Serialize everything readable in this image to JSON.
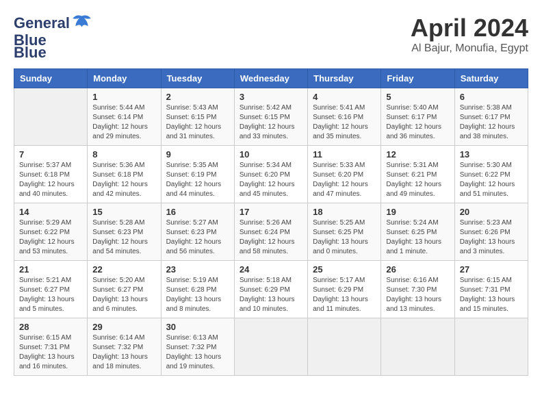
{
  "header": {
    "logo_line1": "General",
    "logo_line2": "Blue",
    "month": "April 2024",
    "location": "Al Bajur, Monufia, Egypt"
  },
  "weekdays": [
    "Sunday",
    "Monday",
    "Tuesday",
    "Wednesday",
    "Thursday",
    "Friday",
    "Saturday"
  ],
  "weeks": [
    [
      {
        "day": "",
        "sunrise": "",
        "sunset": "",
        "daylight": ""
      },
      {
        "day": "1",
        "sunrise": "Sunrise: 5:44 AM",
        "sunset": "Sunset: 6:14 PM",
        "daylight": "Daylight: 12 hours and 29 minutes."
      },
      {
        "day": "2",
        "sunrise": "Sunrise: 5:43 AM",
        "sunset": "Sunset: 6:15 PM",
        "daylight": "Daylight: 12 hours and 31 minutes."
      },
      {
        "day": "3",
        "sunrise": "Sunrise: 5:42 AM",
        "sunset": "Sunset: 6:15 PM",
        "daylight": "Daylight: 12 hours and 33 minutes."
      },
      {
        "day": "4",
        "sunrise": "Sunrise: 5:41 AM",
        "sunset": "Sunset: 6:16 PM",
        "daylight": "Daylight: 12 hours and 35 minutes."
      },
      {
        "day": "5",
        "sunrise": "Sunrise: 5:40 AM",
        "sunset": "Sunset: 6:17 PM",
        "daylight": "Daylight: 12 hours and 36 minutes."
      },
      {
        "day": "6",
        "sunrise": "Sunrise: 5:38 AM",
        "sunset": "Sunset: 6:17 PM",
        "daylight": "Daylight: 12 hours and 38 minutes."
      }
    ],
    [
      {
        "day": "7",
        "sunrise": "Sunrise: 5:37 AM",
        "sunset": "Sunset: 6:18 PM",
        "daylight": "Daylight: 12 hours and 40 minutes."
      },
      {
        "day": "8",
        "sunrise": "Sunrise: 5:36 AM",
        "sunset": "Sunset: 6:18 PM",
        "daylight": "Daylight: 12 hours and 42 minutes."
      },
      {
        "day": "9",
        "sunrise": "Sunrise: 5:35 AM",
        "sunset": "Sunset: 6:19 PM",
        "daylight": "Daylight: 12 hours and 44 minutes."
      },
      {
        "day": "10",
        "sunrise": "Sunrise: 5:34 AM",
        "sunset": "Sunset: 6:20 PM",
        "daylight": "Daylight: 12 hours and 45 minutes."
      },
      {
        "day": "11",
        "sunrise": "Sunrise: 5:33 AM",
        "sunset": "Sunset: 6:20 PM",
        "daylight": "Daylight: 12 hours and 47 minutes."
      },
      {
        "day": "12",
        "sunrise": "Sunrise: 5:31 AM",
        "sunset": "Sunset: 6:21 PM",
        "daylight": "Daylight: 12 hours and 49 minutes."
      },
      {
        "day": "13",
        "sunrise": "Sunrise: 5:30 AM",
        "sunset": "Sunset: 6:22 PM",
        "daylight": "Daylight: 12 hours and 51 minutes."
      }
    ],
    [
      {
        "day": "14",
        "sunrise": "Sunrise: 5:29 AM",
        "sunset": "Sunset: 6:22 PM",
        "daylight": "Daylight: 12 hours and 53 minutes."
      },
      {
        "day": "15",
        "sunrise": "Sunrise: 5:28 AM",
        "sunset": "Sunset: 6:23 PM",
        "daylight": "Daylight: 12 hours and 54 minutes."
      },
      {
        "day": "16",
        "sunrise": "Sunrise: 5:27 AM",
        "sunset": "Sunset: 6:23 PM",
        "daylight": "Daylight: 12 hours and 56 minutes."
      },
      {
        "day": "17",
        "sunrise": "Sunrise: 5:26 AM",
        "sunset": "Sunset: 6:24 PM",
        "daylight": "Daylight: 12 hours and 58 minutes."
      },
      {
        "day": "18",
        "sunrise": "Sunrise: 5:25 AM",
        "sunset": "Sunset: 6:25 PM",
        "daylight": "Daylight: 13 hours and 0 minutes."
      },
      {
        "day": "19",
        "sunrise": "Sunrise: 5:24 AM",
        "sunset": "Sunset: 6:25 PM",
        "daylight": "Daylight: 13 hours and 1 minute."
      },
      {
        "day": "20",
        "sunrise": "Sunrise: 5:23 AM",
        "sunset": "Sunset: 6:26 PM",
        "daylight": "Daylight: 13 hours and 3 minutes."
      }
    ],
    [
      {
        "day": "21",
        "sunrise": "Sunrise: 5:21 AM",
        "sunset": "Sunset: 6:27 PM",
        "daylight": "Daylight: 13 hours and 5 minutes."
      },
      {
        "day": "22",
        "sunrise": "Sunrise: 5:20 AM",
        "sunset": "Sunset: 6:27 PM",
        "daylight": "Daylight: 13 hours and 6 minutes."
      },
      {
        "day": "23",
        "sunrise": "Sunrise: 5:19 AM",
        "sunset": "Sunset: 6:28 PM",
        "daylight": "Daylight: 13 hours and 8 minutes."
      },
      {
        "day": "24",
        "sunrise": "Sunrise: 5:18 AM",
        "sunset": "Sunset: 6:29 PM",
        "daylight": "Daylight: 13 hours and 10 minutes."
      },
      {
        "day": "25",
        "sunrise": "Sunrise: 5:17 AM",
        "sunset": "Sunset: 6:29 PM",
        "daylight": "Daylight: 13 hours and 11 minutes."
      },
      {
        "day": "26",
        "sunrise": "Sunrise: 6:16 AM",
        "sunset": "Sunset: 7:30 PM",
        "daylight": "Daylight: 13 hours and 13 minutes."
      },
      {
        "day": "27",
        "sunrise": "Sunrise: 6:15 AM",
        "sunset": "Sunset: 7:31 PM",
        "daylight": "Daylight: 13 hours and 15 minutes."
      }
    ],
    [
      {
        "day": "28",
        "sunrise": "Sunrise: 6:15 AM",
        "sunset": "Sunset: 7:31 PM",
        "daylight": "Daylight: 13 hours and 16 minutes."
      },
      {
        "day": "29",
        "sunrise": "Sunrise: 6:14 AM",
        "sunset": "Sunset: 7:32 PM",
        "daylight": "Daylight: 13 hours and 18 minutes."
      },
      {
        "day": "30",
        "sunrise": "Sunrise: 6:13 AM",
        "sunset": "Sunset: 7:32 PM",
        "daylight": "Daylight: 13 hours and 19 minutes."
      },
      {
        "day": "",
        "sunrise": "",
        "sunset": "",
        "daylight": ""
      },
      {
        "day": "",
        "sunrise": "",
        "sunset": "",
        "daylight": ""
      },
      {
        "day": "",
        "sunrise": "",
        "sunset": "",
        "daylight": ""
      },
      {
        "day": "",
        "sunrise": "",
        "sunset": "",
        "daylight": ""
      }
    ]
  ]
}
